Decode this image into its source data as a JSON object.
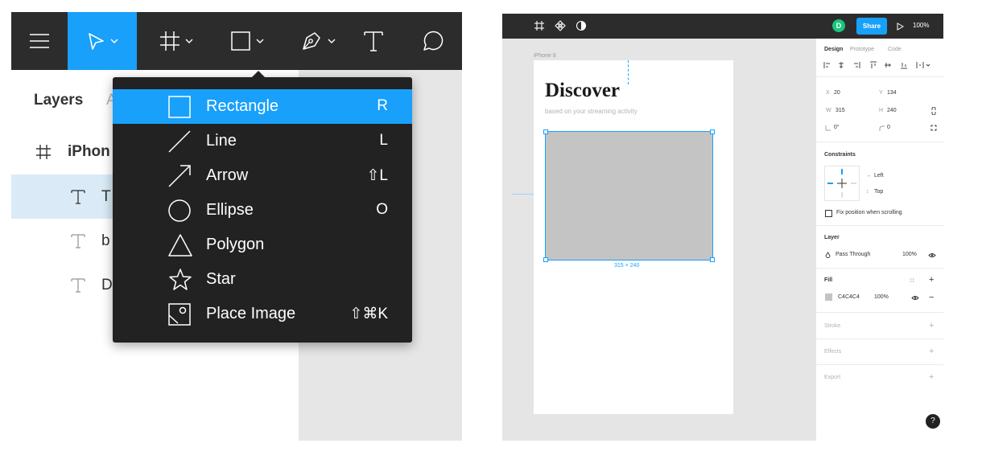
{
  "left": {
    "layers_tab": "Layers",
    "assets_tab_partial": "A",
    "layer_rows": [
      {
        "label": "iPhon",
        "icon": "frame-hash-icon"
      },
      {
        "label": "T",
        "icon": "text-icon"
      },
      {
        "label": "b",
        "icon": "text-icon"
      },
      {
        "label": "D",
        "icon": "text-icon"
      }
    ],
    "shape_menu": [
      {
        "label": "Rectangle",
        "shortcut": "R",
        "icon": "rectangle-icon"
      },
      {
        "label": "Line",
        "shortcut": "L",
        "icon": "line-icon"
      },
      {
        "label": "Arrow",
        "shortcut": "⇧L",
        "icon": "arrow-icon"
      },
      {
        "label": "Ellipse",
        "shortcut": "O",
        "icon": "ellipse-icon"
      },
      {
        "label": "Polygon",
        "shortcut": "",
        "icon": "polygon-icon"
      },
      {
        "label": "Star",
        "shortcut": "",
        "icon": "star-icon"
      },
      {
        "label": "Place Image",
        "shortcut": "⇧⌘K",
        "icon": "place-image-icon"
      }
    ]
  },
  "right": {
    "avatar_initial": "D",
    "share_label": "Share",
    "zoom": "100%",
    "frame_label": "iPhone 8",
    "discover_title": "Discover",
    "discover_subtitle": "based on your streaming activity",
    "dimension_label": "315 × 240",
    "tabs": {
      "design": "Design",
      "prototype": "Prototype",
      "code": "Code"
    },
    "x_label": "X",
    "x_value": "20",
    "y_label": "Y",
    "y_value": "134",
    "w_label": "W",
    "w_value": "315",
    "h_label": "H",
    "h_value": "240",
    "rotation": "0°",
    "radius": "0",
    "constraints_title": "Constraints",
    "constraint_h": "Left",
    "constraint_v": "Top",
    "fix_position": "Fix position when scrolling",
    "layer_title": "Layer",
    "blend_mode": "Pass Through",
    "layer_opacity": "100%",
    "fill_title": "Fill",
    "fill_hex": "C4C4C4",
    "fill_opacity": "100%",
    "stroke_title": "Stroke",
    "effects_title": "Effects",
    "export_title": "Export",
    "help": "?"
  },
  "colors": {
    "accent": "#18a0fb",
    "toolbar": "#2c2c2c",
    "fill": "#c4c4c4",
    "avatar": "#1bc47d"
  }
}
